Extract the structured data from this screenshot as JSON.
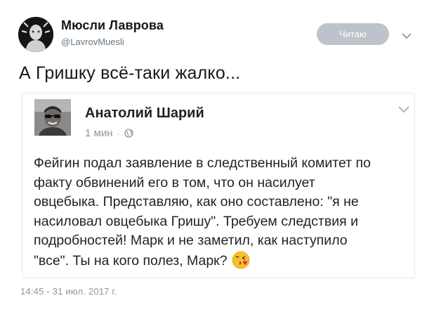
{
  "tweet": {
    "author": {
      "name": "Мюсли Лаврова",
      "handle": "@LavrovMuesli"
    },
    "follow_button_label": "Читаю",
    "text": "А Гришку всё-таки жалко...",
    "timestamp": "14:45 - 31 июл. 2017 г."
  },
  "embedded_post": {
    "author_name": "Анатолий Шарий",
    "time": "1 мин",
    "separator": "·",
    "body_lines": [
      "Фейгин подал заявление в следственный комитет по",
      "факту обвинений его в том, что он насилует",
      "овцебыка. Представляю, как оно составлено: \"я не",
      "насиловал овцебыка Гришу\". Требуем следствия и",
      "подробностей! Марк и не заметил, как наступило",
      "\"все\". Ты на кого полез, Марк?"
    ],
    "emoji": "kissing-face-emoji"
  },
  "colors": {
    "follow_button_bg": "#bcc3ca",
    "handle": "#657786",
    "card_border": "#e1e8ed",
    "meta_text": "#90949c"
  }
}
